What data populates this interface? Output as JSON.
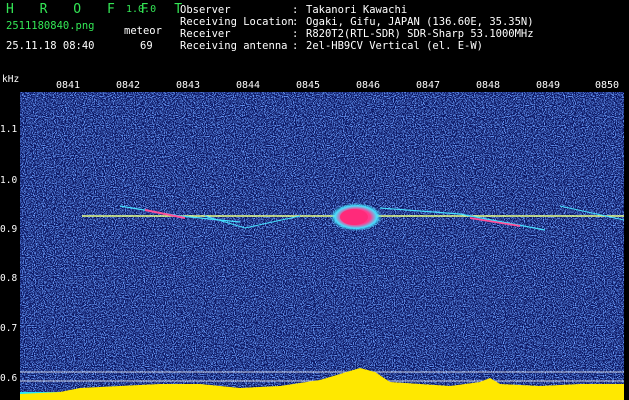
{
  "header": {
    "app_title": "H R O F F T",
    "app_version": "1.0.0",
    "filename": "2511180840.png",
    "timestamp": "25.11.18 08:40",
    "meteor_label": "meteor",
    "meteor_count": "69"
  },
  "info": [
    {
      "key": "Observer",
      "sep": ":",
      "value": "Takanori Kawachi"
    },
    {
      "key": "Receiving Location",
      "sep": ":",
      "value": "Ogaki, Gifu, JAPAN (136.60E, 35.35N)"
    },
    {
      "key": "Receiver",
      "sep": ":",
      "value": "R820T2(RTL-SDR) SDR-Sharp 53.1000MHz"
    },
    {
      "key": "Receiving antenna",
      "sep": ":",
      "value": "2el-HB9CV Vertical (el. E-W)"
    }
  ],
  "time_axis": [
    "0841",
    "0842",
    "0843",
    "0844",
    "0845",
    "0846",
    "0847",
    "0848",
    "0849",
    "0850"
  ],
  "freq_axis": {
    "unit": "kHz",
    "ticks": [
      "1.1",
      "1.0",
      "0.9",
      "0.8",
      "0.7",
      "0.6"
    ]
  },
  "colors": {
    "title_green": "#33e655",
    "background": "#000000",
    "carrier": "#e8ff88",
    "echo_head": "#ff2a7a",
    "signal_bar": "#ffe800",
    "noise_floor": "#1a2ea8"
  }
}
